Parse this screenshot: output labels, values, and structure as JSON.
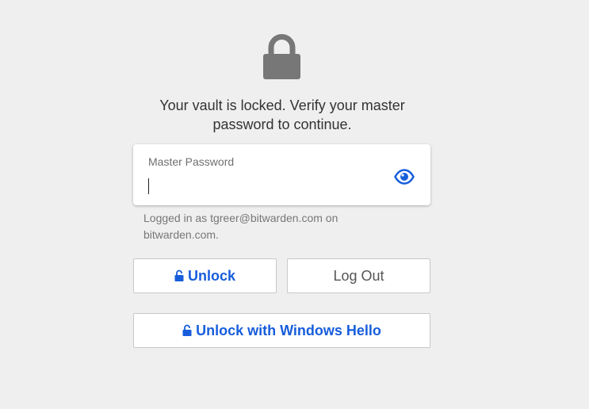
{
  "lock_screen": {
    "hero_icon": "lock-icon",
    "message": "Your vault is locked. Verify your master password to continue.",
    "password_field": {
      "label": "Master Password",
      "value": "",
      "toggle_icon": "eye-icon"
    },
    "logged_in_text": "Logged in as tgreer@bitwarden.com on bitwarden.com.",
    "buttons": {
      "unlock": {
        "label": "Unlock",
        "icon": "unlock-icon"
      },
      "logout": {
        "label": "Log Out"
      },
      "windows_hello": {
        "label": "Unlock with Windows Hello",
        "icon": "unlock-icon"
      }
    }
  },
  "colors": {
    "background": "#efefef",
    "accent": "#175ddc",
    "hero_icon": "#777777"
  }
}
